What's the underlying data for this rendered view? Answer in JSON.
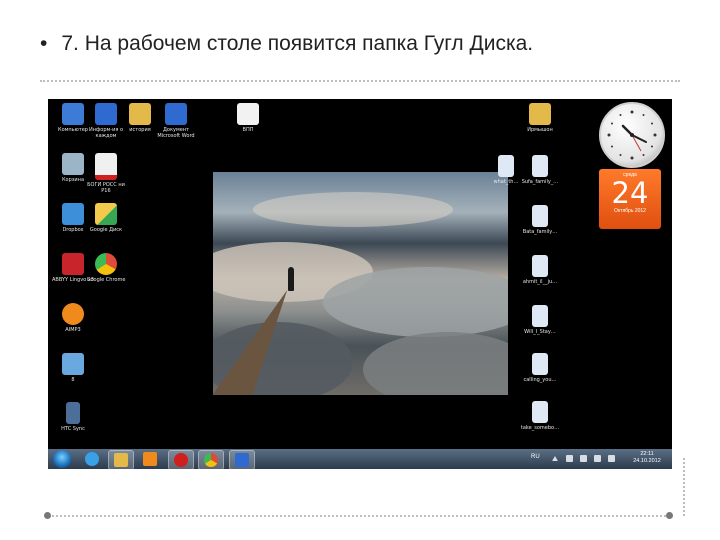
{
  "slide": {
    "bullet": "•",
    "title": "7. На рабочем столе появится папка Гугл Диска."
  },
  "desktop_icons": [
    {
      "name": "computer",
      "label": "Компьютер",
      "icon": "computer-icon",
      "color": "#3c7bd6"
    },
    {
      "name": "word-doc-1",
      "label": "Информ-ия о каждом",
      "icon": "word-document-icon",
      "color": "#2f6ad0"
    },
    {
      "name": "history",
      "label": "история",
      "icon": "folder-icon",
      "color": "#e3b94a"
    },
    {
      "name": "word-doc-2",
      "label": "Документ Microsoft Word",
      "icon": "word-document-icon",
      "color": "#2f6ad0"
    },
    {
      "name": "bpp",
      "label": "ВПП",
      "icon": "document-icon",
      "color": "#f2f2f2"
    },
    {
      "name": "folder-right",
      "label": "Ирмышон",
      "icon": "folder-icon",
      "color": "#e3b94a"
    },
    {
      "name": "recycle-bin",
      "label": "Корзина",
      "icon": "recycle-bin-icon",
      "color": "#9bb4c8"
    },
    {
      "name": "doc-red",
      "label": "БОГИ РОСС ни Р16",
      "icon": "document-icon",
      "color": "#f0f0f0"
    },
    {
      "name": "dropbox",
      "label": "Dropbox",
      "icon": "dropbox-icon",
      "color": "#3d8fd9"
    },
    {
      "name": "google-drive",
      "label": "Google Диск",
      "icon": "google-drive-folder-icon",
      "color": "#f2c94c"
    },
    {
      "name": "abbyy",
      "label": "ABBYY Lingvo x3",
      "icon": "abbyy-icon",
      "color": "#c8242b"
    },
    {
      "name": "chrome",
      "label": "Google Chrome",
      "icon": "chrome-icon",
      "color": "#dd4b39"
    },
    {
      "name": "aimp",
      "label": "AIMP3",
      "icon": "aimp-icon",
      "color": "#f08a1c"
    },
    {
      "name": "search-shortcut",
      "label": "8",
      "icon": "search-icon",
      "color": "#6aa8e0"
    },
    {
      "name": "htc-sync",
      "label": "HTC Sync",
      "icon": "phone-icon",
      "color": "#4c6f9a"
    },
    {
      "name": "audio-1",
      "label": "what_th…",
      "icon": "audio-file-icon",
      "color": "#dfe8f5"
    },
    {
      "name": "audio-2",
      "label": "Sufa_family_…",
      "icon": "audio-file-icon",
      "color": "#dfe8f5"
    },
    {
      "name": "audio-3",
      "label": "Bata_family…",
      "icon": "audio-file-icon",
      "color": "#dfe8f5"
    },
    {
      "name": "audio-4",
      "label": "ahmit_il__ju…",
      "icon": "audio-file-icon",
      "color": "#dfe8f5"
    },
    {
      "name": "audio-5",
      "label": "Will_I_Stay…",
      "icon": "audio-file-icon",
      "color": "#dfe8f5"
    },
    {
      "name": "audio-6",
      "label": "calling_you…",
      "icon": "audio-file-icon",
      "color": "#dfe8f5"
    },
    {
      "name": "audio-7",
      "label": "take_somebo…",
      "icon": "audio-file-icon",
      "color": "#dfe8f5"
    }
  ],
  "calendar": {
    "day_name": "среда",
    "day_number": "24",
    "month_year": "Октябрь 2012"
  },
  "taskbar": {
    "buttons": [
      {
        "name": "start",
        "icon": "windows-start-icon"
      },
      {
        "name": "ie",
        "icon": "internet-explorer-icon",
        "color": "#3aa0e8"
      },
      {
        "name": "explorer",
        "icon": "folder-icon",
        "color": "#e3b94a"
      },
      {
        "name": "media",
        "icon": "media-player-icon",
        "color": "#f08a1c"
      },
      {
        "name": "opera",
        "icon": "opera-icon",
        "color": "#d0201e"
      },
      {
        "name": "chrome",
        "icon": "chrome-icon",
        "color": "#dd4b39"
      },
      {
        "name": "word",
        "icon": "word-icon",
        "color": "#2f6ad0"
      }
    ],
    "language": "RU",
    "time": "22:11",
    "date": "24.10.2012"
  }
}
